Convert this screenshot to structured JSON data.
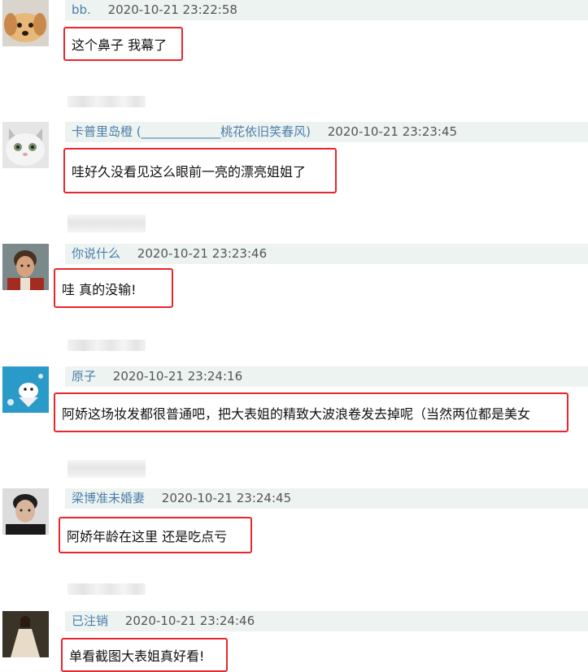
{
  "comments": [
    {
      "username": "bb.",
      "time": "2020-10-21 23:22:58",
      "text": "这个鼻子 我幕了",
      "avatar_icon": "puppy-avatar-icon"
    },
    {
      "username": "卡普里岛橙 (_____________桃花依旧笑春风)",
      "time": "2020-10-21 23:23:45",
      "text": "哇好久没看见这么眼前一亮的漂亮姐姐了",
      "avatar_icon": "kitten-avatar-icon"
    },
    {
      "username": "你说什么",
      "time": "2020-10-21 23:23:46",
      "text": "哇 真的没输!",
      "avatar_icon": "man-portrait-avatar-icon"
    },
    {
      "username": "原子",
      "time": "2020-10-21 23:24:16",
      "text": "阿娇这场妆发都很普通吧，把大表姐的精致大波浪卷发去掉呢（当然两位都是美女",
      "avatar_icon": "cartoon-avatar-icon"
    },
    {
      "username": "梁博准未婚妻",
      "time": "2020-10-21 23:24:45",
      "text": "阿娇年龄在这里 还是吃点亏",
      "avatar_icon": "man-avatar-icon"
    },
    {
      "username": "已注销",
      "time": "2020-10-21 23:24:46",
      "text": "单看截图大表姐真好看!",
      "avatar_icon": "woman-dress-avatar-icon"
    }
  ],
  "colors": {
    "highlight_border": "#e8262b",
    "username": "#4a7eaa",
    "meta_bar_background": "#edf3f0"
  }
}
